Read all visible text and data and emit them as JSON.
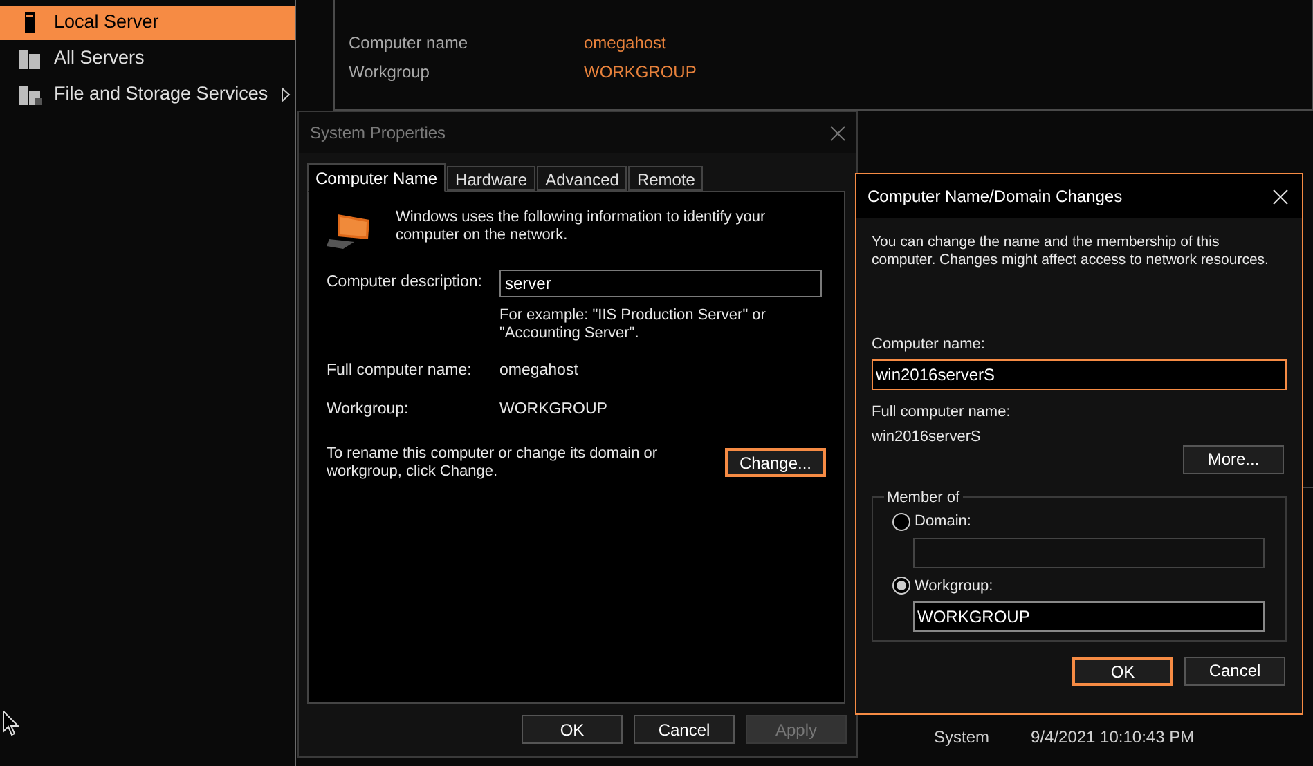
{
  "sidebar": {
    "items": [
      {
        "label": "Local Server",
        "selected": true,
        "kind": "server"
      },
      {
        "label": "All Servers",
        "selected": false,
        "kind": "servers"
      },
      {
        "label": "File and Storage Services",
        "selected": false,
        "kind": "storage",
        "has_submenu": true
      }
    ]
  },
  "properties": [
    {
      "label": "Computer name",
      "value": "omegahost"
    },
    {
      "label": "Workgroup",
      "value": "WORKGROUP"
    }
  ],
  "events_row": {
    "source": "System",
    "date": "9/4/2021 10:10:43 PM"
  },
  "system_properties": {
    "title": "System Properties",
    "tabs": [
      {
        "label": "Computer Name",
        "selected": true
      },
      {
        "label": "Hardware",
        "selected": false
      },
      {
        "label": "Advanced",
        "selected": false
      },
      {
        "label": "Remote",
        "selected": false
      }
    ],
    "intro": "Windows uses the following information to identify your computer on the network.",
    "description_label": "Computer description:",
    "description_value": "server",
    "example": "For example: \"IIS Production Server\" or \"Accounting Server\".",
    "full_name_label": "Full computer name:",
    "full_name_value": "omegahost",
    "workgroup_label": "Workgroup:",
    "workgroup_value": "WORKGROUP",
    "rename_text": "To rename this computer or change its domain or workgroup, click Change.",
    "change_button": {
      "label": "Change...",
      "focused": true
    },
    "buttons": [
      {
        "label": "OK",
        "disabled": false
      },
      {
        "label": "Cancel",
        "disabled": false
      },
      {
        "label": "Apply",
        "disabled": true
      }
    ]
  },
  "domain_dialog": {
    "title": "Computer Name/Domain Changes",
    "intro": "You can change the name and the membership of this computer. Changes might affect access to network resources.",
    "name_label": "Computer name:",
    "name_value": "win2016serverS",
    "full_name_label": "Full computer name:",
    "full_name_value": "win2016serverS",
    "more_button": "More...",
    "member_of": {
      "label": "Member of",
      "options": [
        {
          "label": "Domain:",
          "selected": false
        },
        {
          "label": "Workgroup:",
          "selected": true,
          "value": "WORKGROUP"
        }
      ]
    },
    "buttons": [
      {
        "label": "OK",
        "focused": true
      },
      {
        "label": "Cancel",
        "focused": false
      }
    ]
  }
}
